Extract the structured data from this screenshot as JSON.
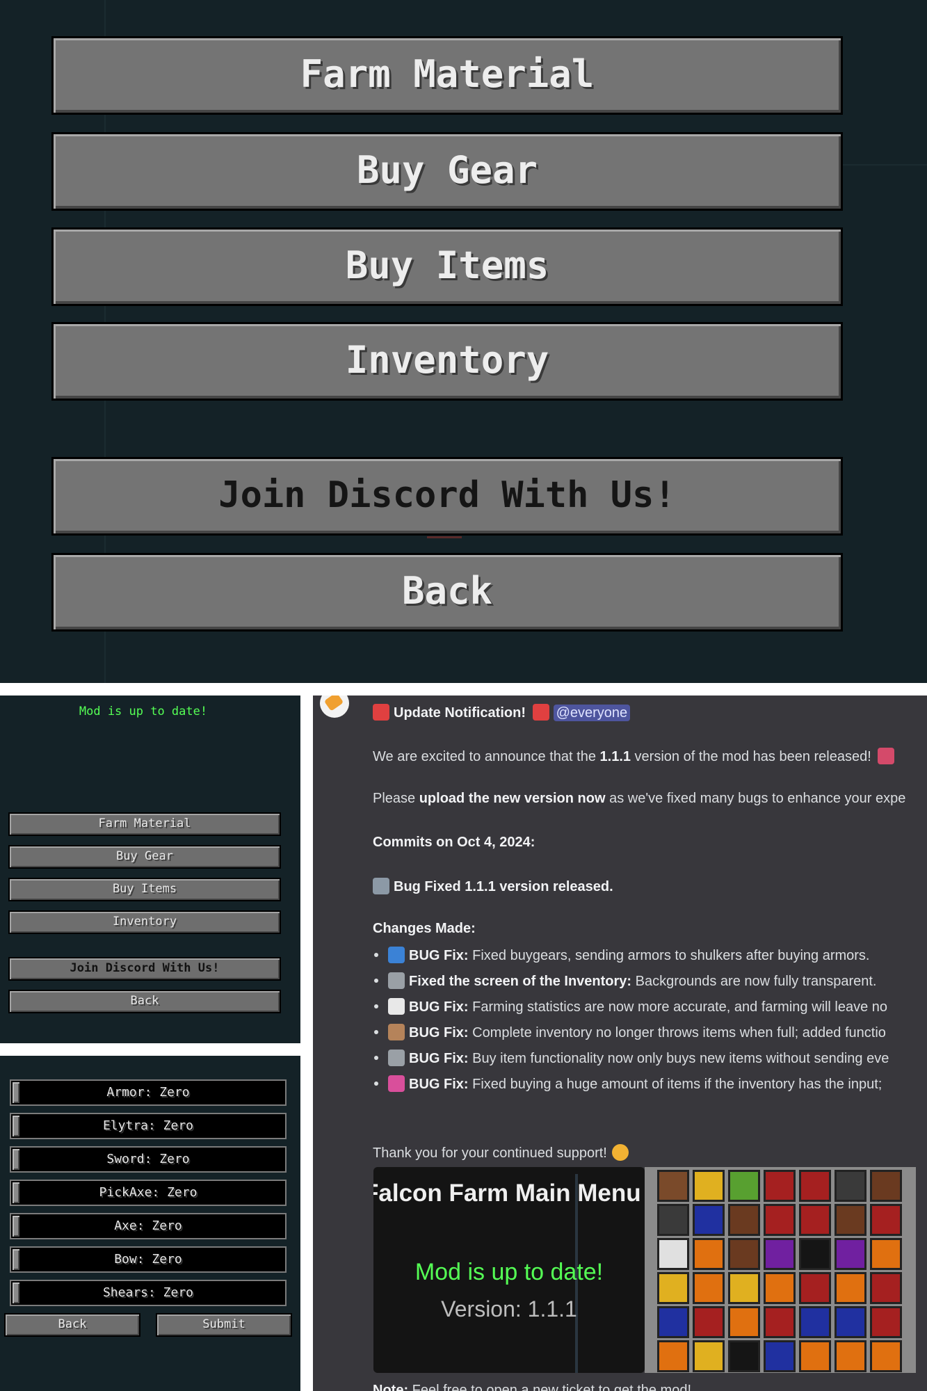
{
  "main_menu": {
    "buttons": [
      "Farm Material",
      "Buy Gear",
      "Buy Items",
      "Inventory"
    ],
    "discord_label": "Join Discord With Us!",
    "back_label": "Back"
  },
  "small_menu": {
    "status": "Mod is up to date!",
    "buttons": [
      "Farm Material",
      "Buy Gear",
      "Buy Items",
      "Inventory"
    ],
    "discord_label": "Join Discord With Us!",
    "back_label": "Back"
  },
  "gear_menu": {
    "sliders": [
      {
        "label": "Armor: Zero",
        "level": 0
      },
      {
        "label": "Elytra: Zero",
        "level": 0
      },
      {
        "label": "Sword: Zero",
        "level": 0
      },
      {
        "label": "PickAxe: Zero",
        "level": 0
      },
      {
        "label": "Axe: Zero",
        "level": 0
      },
      {
        "label": "Bow: Zero",
        "level": 0
      },
      {
        "label": "Shears: Zero",
        "level": 0
      }
    ],
    "back_label": "Back",
    "submit_label": "Submit"
  },
  "announcement": {
    "title": "Update Notification!",
    "mention": "@everyone",
    "intro_pre": "We are excited to announce that the ",
    "intro_version": "1.1.1",
    "intro_post": " version of the mod has been released!",
    "upload_pre": "Please ",
    "upload_bold": "upload the new version now",
    "upload_post": " as we've fixed many bugs to enhance your expe",
    "commits": "Commits on Oct 4, 2024:",
    "bugfix_line": "Bug Fixed 1.1.1 version released.",
    "changes_heading": "Changes Made:",
    "changes": [
      {
        "icon": "shield-icon",
        "color": "#3b82d6",
        "bold": "BUG Fix:",
        "text": " Fixed buygears, sending armors to shulkers after buying armors."
      },
      {
        "icon": "hammer-wrench-icon",
        "color": "#9aa0a6",
        "bold": "Fixed the screen of the Inventory:",
        "text": " Backgrounds are now fully transparent."
      },
      {
        "icon": "chart-up-icon",
        "color": "#e8e8e8",
        "bold": "BUG Fix:",
        "text": " Farming statistics are now more accurate, and farming will leave no"
      },
      {
        "icon": "package-icon",
        "color": "#b5835a",
        "bold": "BUG Fix:",
        "text": " Complete inventory no longer throws items when full; added functio"
      },
      {
        "icon": "cart-icon",
        "color": "#9aa0a6",
        "bold": "BUG Fix:",
        "text": " Buy item functionality now only buys new items without sending eve"
      },
      {
        "icon": "shopping-bags-icon",
        "color": "#d94f9b",
        "bold": "BUG Fix:",
        "text": " Fixed buying a huge amount of items if the inventory has the input;"
      }
    ],
    "thanks": "Thank you for your continued support!",
    "note_bold": "Note:",
    "note_text": " Feel free to open a new ticket to get the mod!"
  },
  "preview": {
    "title": "Falcon Farm Main Menu",
    "status": "Mod is up to date!",
    "version": "Version: 1.1.1"
  },
  "colors": {
    "panel_bg": "#142227",
    "status_green": "#55ff55",
    "chat_bg": "#38373c",
    "mention_bg": "#4e559e"
  }
}
